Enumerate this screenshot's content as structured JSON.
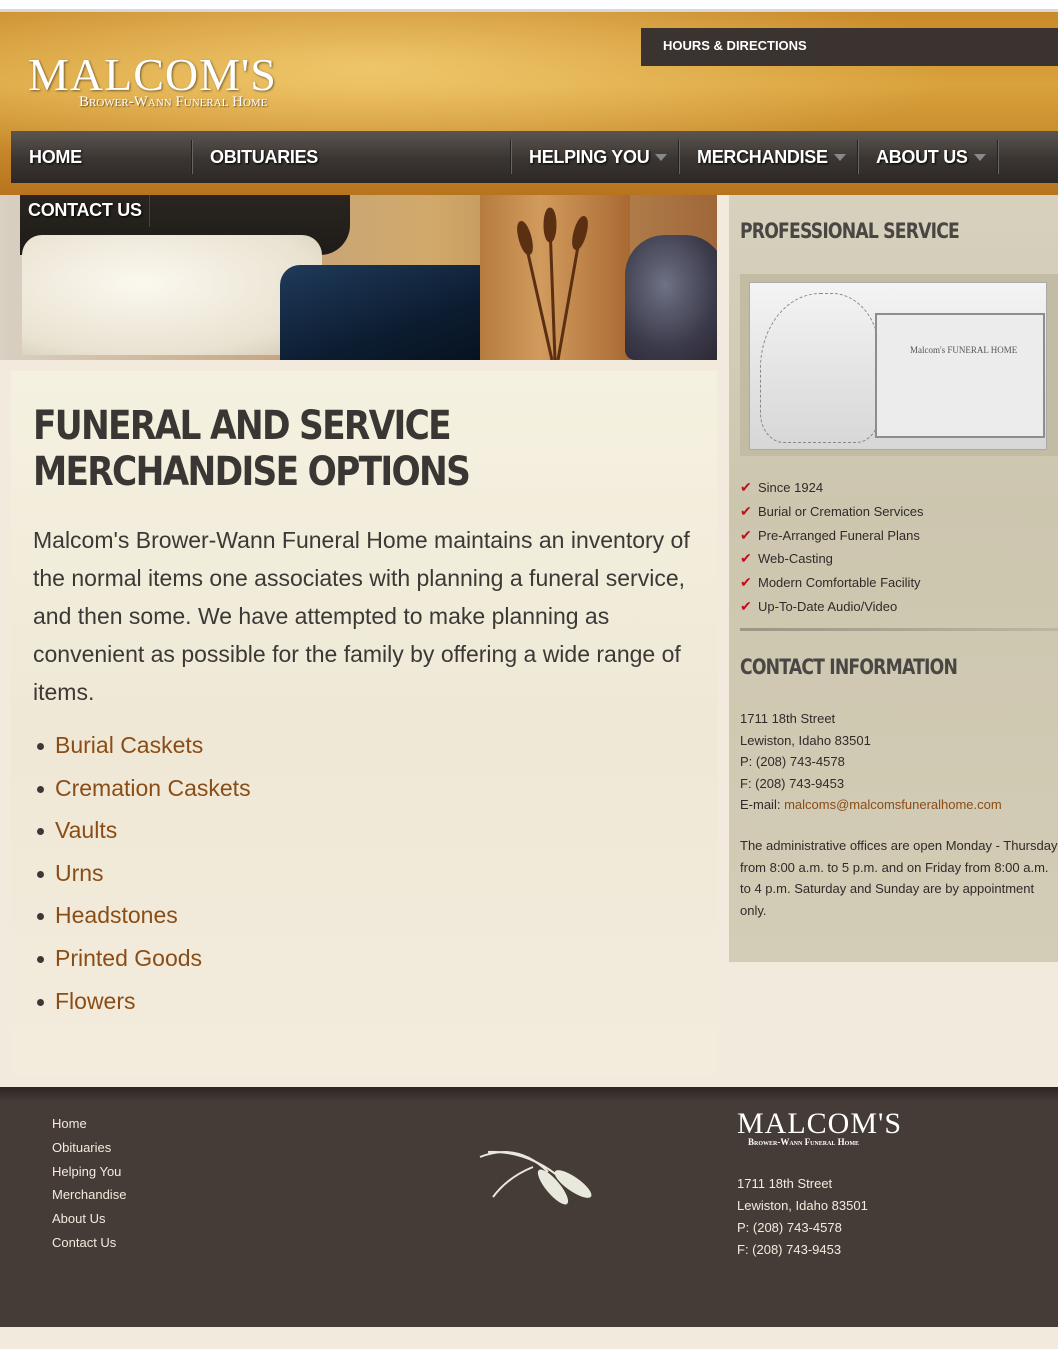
{
  "header": {
    "logo_main": "MALCOM'S",
    "logo_sub": "Brower-Wann Funeral Home",
    "top_link": "HOURS & DIRECTIONS"
  },
  "nav": {
    "items": [
      {
        "label": "HOME"
      },
      {
        "label": "OBITUARIES"
      },
      {
        "label": "HELPING YOU"
      },
      {
        "label": "MERCHANDISE"
      },
      {
        "label": "ABOUT US"
      },
      {
        "label": "CONTACT US"
      }
    ]
  },
  "main": {
    "title": "FUNERAL AND SERVICE MERCHANDISE OPTIONS",
    "intro": "Malcom's Brower-Wann Funeral Home maintains an inventory of the normal items one associates with planning a funeral service, and then some. We have attempted to make planning as convenient as possible for the family by offering a wide range of items.",
    "links": [
      "Burial Caskets",
      "Cremation Caskets",
      "Vaults",
      "Urns",
      "Headstones",
      "Printed Goods",
      "Flowers"
    ]
  },
  "sidebar": {
    "professional_heading": "PROFESSIONAL SERVICE",
    "photo_sign": "Malcom's FUNERAL HOME",
    "features": [
      "Since 1924",
      "Burial or Cremation Services",
      "Pre-Arranged Funeral Plans",
      "Web-Casting",
      "Modern Comfortable Facility",
      "Up-To-Date Audio/Video"
    ],
    "contact_heading": "CONTACT INFORMATION",
    "address1": "1711 18th Street",
    "address2": "Lewiston, Idaho 83501",
    "phone": "P: (208) 743-4578",
    "fax": "F: (208) 743-9453",
    "email_label": "E-mail: ",
    "email": "malcoms@malcomsfuneralhome.com",
    "hours": "The administrative offices are open Monday - Thursday from 8:00 a.m. to 5 p.m. and on Friday from 8:00 a.m. to 4 p.m. Saturday and Sunday are by appointment only."
  },
  "footer": {
    "links": [
      "Home",
      "Obituaries",
      "Helping You",
      "Merchandise",
      "About Us",
      "Contact Us"
    ],
    "logo_main": "MALCOM'S",
    "logo_sub": "Brower-Wann Funeral Home",
    "address1": "1711 18th Street",
    "address2": "Lewiston, Idaho 83501",
    "phone": "P: (208) 743-4578",
    "fax": "F: (208) 743-9453"
  },
  "colors": {
    "link": "#8a4d16",
    "check": "#c2101a",
    "nav_bg": "#3b3532",
    "footer_bg": "#453b37"
  }
}
